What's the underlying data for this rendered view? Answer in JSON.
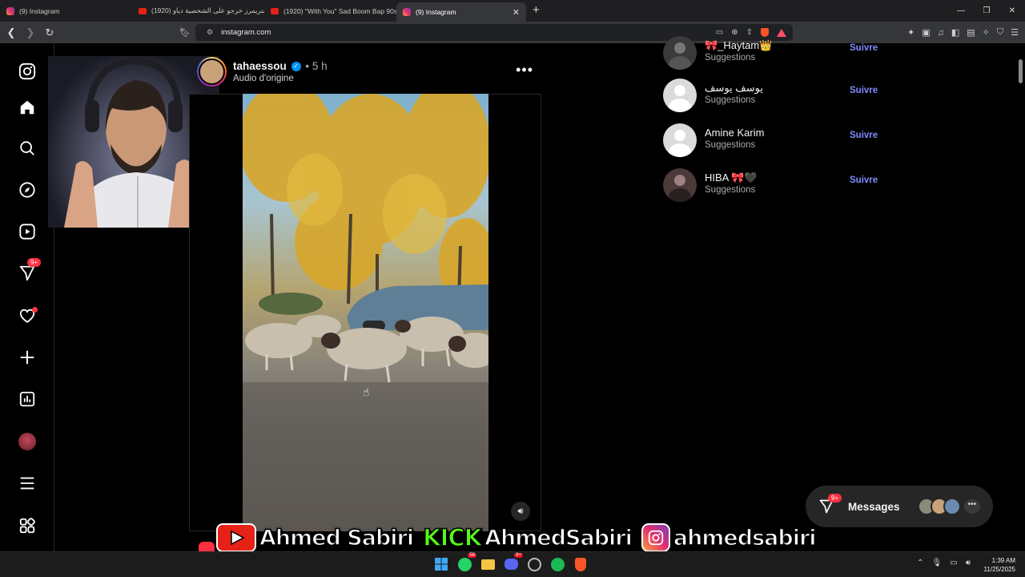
{
  "browser": {
    "tabs": [
      {
        "title": "(9) Instagram",
        "favicon": "instagram-icon",
        "active": false
      },
      {
        "title": "(1920) ستريمرز خرجو على الشخصية دياو",
        "favicon": "youtube-icon",
        "active": false
      },
      {
        "title": "(1920) \"With You\" Sad Boom Bap 90s",
        "favicon": "youtube-icon",
        "active": false
      },
      {
        "title": "(9) Instagram",
        "favicon": "instagram-icon",
        "active": true
      }
    ],
    "new_tab": "+",
    "url": "instagram.com"
  },
  "sidebar": {
    "items": [
      {
        "name": "instagram-logo-icon"
      },
      {
        "name": "home-icon"
      },
      {
        "name": "search-icon"
      },
      {
        "name": "explore-icon"
      },
      {
        "name": "reels-icon"
      },
      {
        "name": "messages-icon",
        "badge": "9+"
      },
      {
        "name": "notifications-icon"
      },
      {
        "name": "create-icon"
      },
      {
        "name": "dashboard-icon"
      },
      {
        "name": "profile-avatar"
      },
      {
        "name": "menu-icon"
      },
      {
        "name": "also-from-meta-icon"
      }
    ]
  },
  "post": {
    "username": "tahaessou",
    "separator": "•",
    "time": "5 h",
    "audio": "Audio d'origine",
    "more": "•••"
  },
  "suggestions": [
    {
      "name": "🎀_Haytam👑",
      "subtitle": "Suggestions",
      "action": "Suivre"
    },
    {
      "name": "يوسف يوسف",
      "subtitle": "Suggestions",
      "action": "Suivre"
    },
    {
      "name": "Amine Karim",
      "subtitle": "Suggestions",
      "action": "Suivre"
    },
    {
      "name": "HIBA 🎀🖤",
      "subtitle": "Suggestions",
      "action": "Suivre"
    }
  ],
  "messages": {
    "label": "Messages",
    "badge": "9+",
    "more": "•••"
  },
  "banner": {
    "youtube_name": "Ahmed Sabiri",
    "kick_label": "KICK",
    "kick_name": "AhmedSabiri",
    "instagram_name": "ahmedsabiri"
  },
  "taskbar": {
    "badges": {
      "whatsapp": "58",
      "discord": "9+"
    },
    "time": "1:39 AM",
    "date": "11/25/2025"
  },
  "colors": {
    "accent_follow": "#7f8cff",
    "notification_red": "#ff3040",
    "kick_green": "#53fc18",
    "verified_blue": "#0095f6"
  }
}
